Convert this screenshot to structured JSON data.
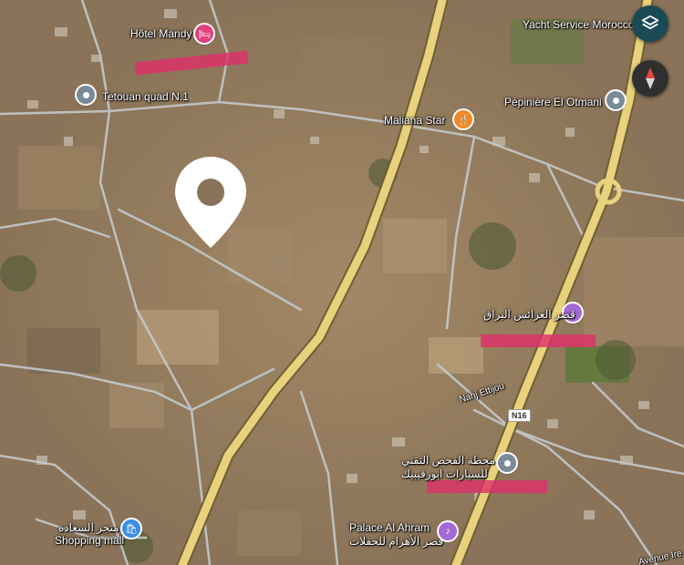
{
  "map": {
    "places": [
      {
        "id": "hotel-mandy",
        "label": "Hôtel Mandy",
        "icon": "hotel-icon"
      },
      {
        "id": "tetouan-quad",
        "label": "Tetouan quad N.1",
        "icon": "place-icon"
      },
      {
        "id": "yacht-service",
        "label": "Yacht Service Morocco",
        "icon": "place-icon"
      },
      {
        "id": "pepiniere",
        "label": "Pépinière El Otmani",
        "icon": "place-icon"
      },
      {
        "id": "maliana-star",
        "label": "Maliana Star",
        "icon": "restaurant-icon"
      },
      {
        "id": "wedding-hall-1",
        "label": "قصر العرائس البراق",
        "icon": "event-venue-icon"
      },
      {
        "id": "inspection-center",
        "label_line1": "محطة الفحص التقني",
        "label_line2": "للسيارات ابورقيبيك",
        "icon": "place-icon"
      },
      {
        "id": "palace-al-ahram",
        "label_line1": "Palace Al Ahram",
        "label_line2": "قصر الأهرام للحفلات",
        "icon": "event-venue-icon"
      },
      {
        "id": "shopping-mall",
        "label_line1": "متجر السعادة",
        "label_line2": "Shopping mall",
        "icon": "shopping-bag-icon"
      }
    ],
    "road_labels": {
      "highway_shield": "N16",
      "street_1": "Nahj Ettijou",
      "street_2": "Avenue Ire"
    },
    "colors": {
      "highway": "#e9d27c",
      "road": "#c4c9cc",
      "marker": "#ffffff",
      "redline": "#e0306a"
    }
  },
  "controls": {
    "layers_icon": "layers-icon",
    "compass_icon": "compass-icon"
  }
}
